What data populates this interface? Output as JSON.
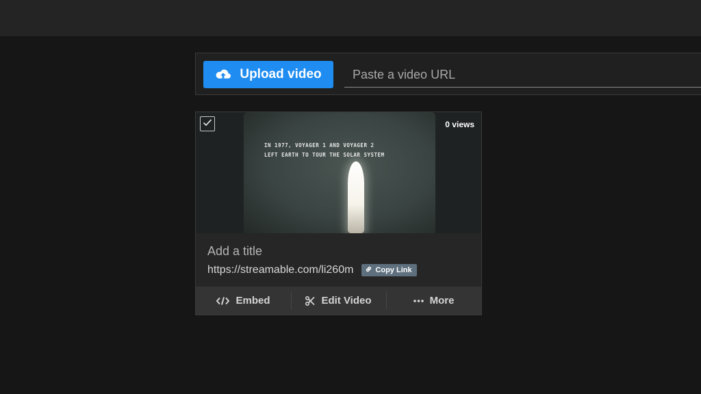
{
  "upload": {
    "button_label": "Upload video",
    "url_placeholder": "Paste a video URL"
  },
  "video": {
    "views": "0 views",
    "thumbnail_caption": "IN 1977, VOYAGER 1 AND VOYAGER 2\nLEFT EARTH TO TOUR THE SOLAR SYSTEM",
    "title_placeholder": "Add a title",
    "link": "https://streamable.com/li260m",
    "copy_link_label": "Copy Link",
    "actions": {
      "embed": "Embed",
      "edit": "Edit Video",
      "more": "More"
    }
  },
  "icons": {
    "upload": "cloud-upload-icon",
    "checkbox": "check-icon",
    "copy": "link-icon",
    "embed": "code-icon",
    "edit": "scissors-icon",
    "more": "ellipsis-icon"
  },
  "colors": {
    "accent": "#1e8cf0",
    "background": "#161616",
    "card": "#262626",
    "copy_badge": "#5e6f7d"
  }
}
